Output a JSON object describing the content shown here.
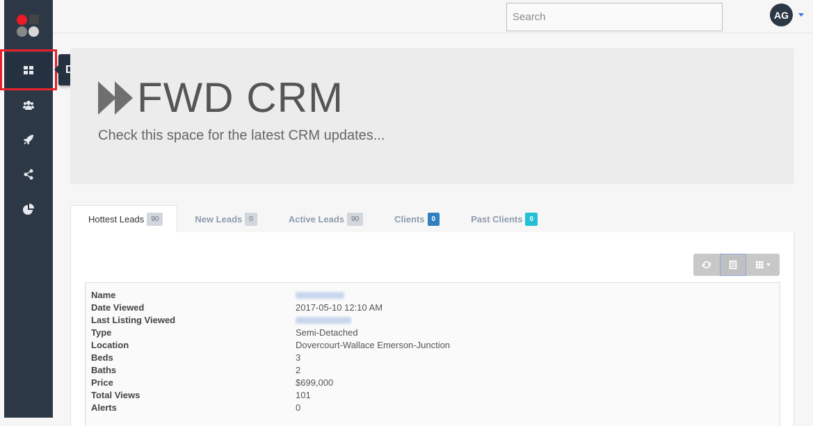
{
  "sidebar": {
    "items": [
      {
        "name": "dashboard",
        "icon": "dashboard-icon"
      },
      {
        "name": "contacts",
        "icon": "users-icon"
      },
      {
        "name": "campaigns",
        "icon": "rocket-icon"
      },
      {
        "name": "share",
        "icon": "share-icon"
      },
      {
        "name": "reports",
        "icon": "pie-chart-icon"
      }
    ],
    "tooltip": "Dashboard"
  },
  "header": {
    "search_placeholder": "Search",
    "avatar_initials": "AG"
  },
  "hero": {
    "title": "FWD CRM",
    "subtitle": "Check this space for the latest CRM updates..."
  },
  "tabs": [
    {
      "label": "Hottest Leads",
      "count": "90"
    },
    {
      "label": "New Leads",
      "count": "0"
    },
    {
      "label": "Active Leads",
      "count": "90"
    },
    {
      "label": "Clients",
      "count": "0"
    },
    {
      "label": "Past Clients",
      "count": "0"
    }
  ],
  "lead": {
    "fields": [
      {
        "key": "Name",
        "value": ""
      },
      {
        "key": "Date Viewed",
        "value": "2017-05-10 12:10 AM"
      },
      {
        "key": "Last Listing Viewed",
        "value": ""
      },
      {
        "key": "Type",
        "value": "Semi-Detached"
      },
      {
        "key": "Location",
        "value": "Dovercourt-Wallace Emerson-Junction"
      },
      {
        "key": "Beds",
        "value": "3"
      },
      {
        "key": "Baths",
        "value": "2"
      },
      {
        "key": "Price",
        "value": "$699,000"
      },
      {
        "key": "Total Views",
        "value": "101"
      },
      {
        "key": "Alerts",
        "value": "0"
      }
    ]
  },
  "colors": {
    "sidebar": "#2d3846",
    "highlight": "#e8202a",
    "badge_blue": "#2f7fc1",
    "badge_teal": "#22c0d6"
  }
}
